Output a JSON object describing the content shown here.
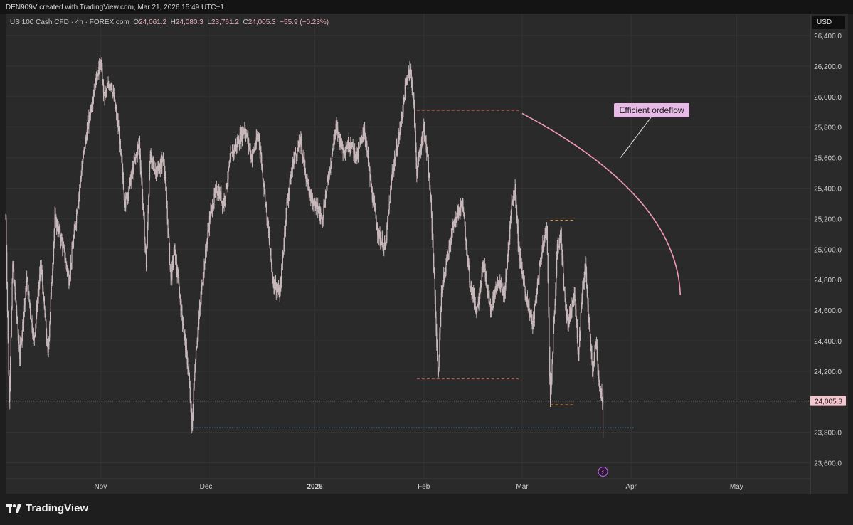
{
  "header": {
    "attribution": "DEN909V created with TradingView.com, Mar 21, 2026 15:49 UTC+1"
  },
  "legend": {
    "symbol": "US 100 Cash CFD · 4h · FOREX.com",
    "o_label": "O",
    "o_value": "24,061.2",
    "h_label": "H",
    "h_value": "24,080.3",
    "l_label": "L",
    "l_value": "23,761.2",
    "c_label": "C",
    "c_value": "24,005.3",
    "change": "−55.9 (−0.23%)"
  },
  "currency": "USD",
  "annotation": {
    "text": "Efficient ordeflow"
  },
  "footer": {
    "brand": "TradingView"
  },
  "colors": {
    "background": "#2a2a2a",
    "candle": "#c8b8bb",
    "red_dashed": "#d05a4a",
    "orange_dashed": "#e09030",
    "cyan_dotted": "#4aa7b5",
    "pink_curve": "#f29ab3",
    "label_bg": "#e7b9e7",
    "price_badge": "#f4c6cf"
  },
  "chart_data": {
    "type": "candlestick",
    "symbol": "US 100 Cash CFD",
    "timeframe": "4h",
    "last_price": 24005.3,
    "last_price_label": "24,005.3",
    "ylim": [
      23500,
      26540
    ],
    "y_ticks": [
      {
        "value": 23600,
        "label": "23,600.0"
      },
      {
        "value": 23800,
        "label": "23,800.0"
      },
      {
        "value": 24000,
        "label": ""
      },
      {
        "value": 24200,
        "label": "24,200.0"
      },
      {
        "value": 24400,
        "label": "24,400.0"
      },
      {
        "value": 24600,
        "label": "24,600.0"
      },
      {
        "value": 24800,
        "label": "24,800.0"
      },
      {
        "value": 25000,
        "label": "25,000.0"
      },
      {
        "value": 25200,
        "label": "25,200.0"
      },
      {
        "value": 25400,
        "label": "25,400.0"
      },
      {
        "value": 25600,
        "label": "25,600.0"
      },
      {
        "value": 25800,
        "label": "25,800.0"
      },
      {
        "value": 26000,
        "label": "26,000.0"
      },
      {
        "value": 26200,
        "label": "26,200.0"
      },
      {
        "value": 26400,
        "label": "26,400.0"
      }
    ],
    "x_ticks": [
      {
        "date": "2025-11-01",
        "label": "Nov",
        "bold": false
      },
      {
        "date": "2025-12-01",
        "label": "Dec",
        "bold": false
      },
      {
        "date": "2026-01-01",
        "label": "2026",
        "bold": true
      },
      {
        "date": "2026-02-01",
        "label": "Feb",
        "bold": false
      },
      {
        "date": "2026-03-01",
        "label": "Mar",
        "bold": false
      },
      {
        "date": "2026-04-01",
        "label": "Apr",
        "bold": false
      },
      {
        "date": "2026-05-01",
        "label": "May",
        "bold": false
      }
    ],
    "xlim": [
      "2025-10-05",
      "2026-05-22"
    ],
    "path": [
      [
        "2025-10-05",
        25200
      ],
      [
        "2025-10-06",
        24000
      ],
      [
        "2025-10-07",
        24900
      ],
      [
        "2025-10-09",
        24300
      ],
      [
        "2025-10-11",
        24800
      ],
      [
        "2025-10-13",
        24400
      ],
      [
        "2025-10-15",
        24900
      ],
      [
        "2025-10-17",
        24300
      ],
      [
        "2025-10-19",
        25200
      ],
      [
        "2025-10-21",
        25050
      ],
      [
        "2025-10-23",
        24800
      ],
      [
        "2025-10-25",
        25200
      ],
      [
        "2025-10-27",
        25600
      ],
      [
        "2025-10-29",
        25900
      ],
      [
        "2025-10-31",
        26150
      ],
      [
        "2025-11-01",
        26230
      ],
      [
        "2025-11-02",
        26000
      ],
      [
        "2025-11-04",
        26100
      ],
      [
        "2025-11-06",
        25800
      ],
      [
        "2025-11-08",
        25300
      ],
      [
        "2025-11-10",
        25500
      ],
      [
        "2025-11-12",
        25700
      ],
      [
        "2025-11-14",
        24900
      ],
      [
        "2025-11-15",
        25600
      ],
      [
        "2025-11-17",
        25500
      ],
      [
        "2025-11-19",
        25600
      ],
      [
        "2025-11-20",
        25200
      ],
      [
        "2025-11-21",
        24800
      ],
      [
        "2025-11-22",
        25000
      ],
      [
        "2025-11-24",
        24600
      ],
      [
        "2025-11-26",
        24200
      ],
      [
        "2025-11-27",
        23830
      ],
      [
        "2025-11-28",
        24300
      ],
      [
        "2025-11-30",
        24800
      ],
      [
        "2025-12-02",
        25200
      ],
      [
        "2025-12-04",
        25400
      ],
      [
        "2025-12-06",
        25300
      ],
      [
        "2025-12-08",
        25600
      ],
      [
        "2025-12-10",
        25700
      ],
      [
        "2025-12-12",
        25800
      ],
      [
        "2025-12-14",
        25600
      ],
      [
        "2025-12-16",
        25750
      ],
      [
        "2025-12-18",
        25300
      ],
      [
        "2025-12-20",
        24800
      ],
      [
        "2025-12-22",
        24700
      ],
      [
        "2025-12-24",
        25300
      ],
      [
        "2025-12-26",
        25600
      ],
      [
        "2025-12-28",
        25700
      ],
      [
        "2025-12-30",
        25400
      ],
      [
        "2026-01-01",
        25300
      ],
      [
        "2026-01-03",
        25200
      ],
      [
        "2026-01-05",
        25500
      ],
      [
        "2026-01-07",
        25800
      ],
      [
        "2026-01-09",
        25650
      ],
      [
        "2026-01-11",
        25700
      ],
      [
        "2026-01-13",
        25600
      ],
      [
        "2026-01-15",
        25800
      ],
      [
        "2026-01-17",
        25400
      ],
      [
        "2026-01-19",
        25100
      ],
      [
        "2026-01-21",
        25000
      ],
      [
        "2026-01-23",
        25500
      ],
      [
        "2026-01-25",
        25750
      ],
      [
        "2026-01-27",
        26100
      ],
      [
        "2026-01-28",
        26200
      ],
      [
        "2026-01-29",
        26000
      ],
      [
        "2026-01-30",
        25500
      ],
      [
        "2026-02-01",
        25800
      ],
      [
        "2026-02-02",
        25600
      ],
      [
        "2026-02-03",
        25300
      ],
      [
        "2026-02-04",
        24800
      ],
      [
        "2026-02-05",
        24150
      ],
      [
        "2026-02-06",
        24700
      ],
      [
        "2026-02-08",
        25000
      ],
      [
        "2026-02-10",
        25200
      ],
      [
        "2026-02-12",
        25300
      ],
      [
        "2026-02-14",
        24800
      ],
      [
        "2026-02-16",
        24600
      ],
      [
        "2026-02-18",
        24900
      ],
      [
        "2026-02-20",
        24600
      ],
      [
        "2026-02-22",
        24800
      ],
      [
        "2026-02-24",
        24700
      ],
      [
        "2026-02-26",
        25300
      ],
      [
        "2026-02-27",
        25400
      ],
      [
        "2026-02-28",
        25000
      ],
      [
        "2026-03-02",
        24700
      ],
      [
        "2026-03-04",
        24500
      ],
      [
        "2026-03-06",
        24900
      ],
      [
        "2026-03-08",
        25150
      ],
      [
        "2026-03-09",
        24000
      ],
      [
        "2026-03-10",
        24500
      ],
      [
        "2026-03-11",
        25000
      ],
      [
        "2026-03-12",
        25100
      ],
      [
        "2026-03-13",
        24700
      ],
      [
        "2026-03-14",
        24500
      ],
      [
        "2026-03-16",
        24700
      ],
      [
        "2026-03-17",
        24300
      ],
      [
        "2026-03-18",
        24700
      ],
      [
        "2026-03-19",
        24900
      ],
      [
        "2026-03-20",
        24500
      ],
      [
        "2026-03-21",
        24200
      ],
      [
        "2026-03-22",
        24400
      ],
      [
        "2026-03-23",
        24100
      ],
      [
        "2026-03-24",
        24005.3
      ]
    ],
    "levels": [
      {
        "name": "red-dashed-high",
        "price": 25910,
        "from": "2026-01-30",
        "to": "2026-02-28",
        "style": "red_dashed"
      },
      {
        "name": "red-dashed-low",
        "price": 24150,
        "from": "2026-01-30",
        "to": "2026-02-28",
        "style": "red_dashed"
      },
      {
        "name": "orange-dashed-high",
        "price": 25190,
        "from": "2026-03-09",
        "to": "2026-03-16",
        "style": "orange_dashed"
      },
      {
        "name": "orange-dashed-low",
        "price": 23980,
        "from": "2026-03-09",
        "to": "2026-03-16",
        "style": "orange_dashed"
      },
      {
        "name": "cyan-dotted-low",
        "price": 23830,
        "from": "2025-11-27",
        "to": "2026-04-02",
        "style": "cyan_dotted"
      }
    ],
    "curve": [
      [
        "2026-03-01",
        25890
      ],
      [
        "2026-04-14",
        25350
      ],
      [
        "2026-04-15",
        24700
      ]
    ],
    "callout_anchor": [
      "2026-03-29",
      25600
    ]
  }
}
